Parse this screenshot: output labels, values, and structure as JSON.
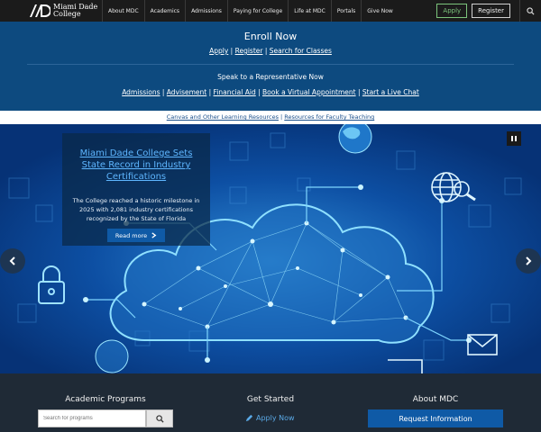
{
  "brand": {
    "name_line1": "Miami Dade",
    "name_line2": "College"
  },
  "nav": {
    "links": [
      "About MDC",
      "Academics",
      "Admissions",
      "Paying for College",
      "Life at MDC",
      "Portals",
      "Give Now"
    ],
    "apply_label": "Apply",
    "register_label": "Register"
  },
  "enroll": {
    "title": "Enroll Now",
    "links": [
      "Apply",
      "Register",
      "Search for Classes"
    ],
    "speak_title": "Speak to a Representative Now",
    "speak_links": [
      "Admissions",
      "Advisement",
      "Financial Aid",
      "Book a Virtual Appointment",
      "Start a Live Chat"
    ]
  },
  "resources": {
    "links": [
      "Canvas and Other Learning Resources",
      "Resources for Faculty Teaching"
    ]
  },
  "hero": {
    "headline": "Miami Dade College Sets State Record in Industry Certifications",
    "body": "The College reached a historic milestone in 2025 with 2,081 industry certifications recognized by the State of Florida",
    "cta_label": "Read more"
  },
  "footer": {
    "col1_title": "Academic Programs",
    "search_placeholder": "Search for programs",
    "col2_title": "Get Started",
    "apply_now_label": "Apply Now",
    "col3_title": "About MDC",
    "request_info_label": "Request Information"
  },
  "colors": {
    "nav_bg": "#1b1b1b",
    "enroll_bg": "#0d4a7f",
    "accent_blue": "#0f5aa6",
    "apply_green": "#7cc47c",
    "footer_bg": "#1f2a36"
  }
}
